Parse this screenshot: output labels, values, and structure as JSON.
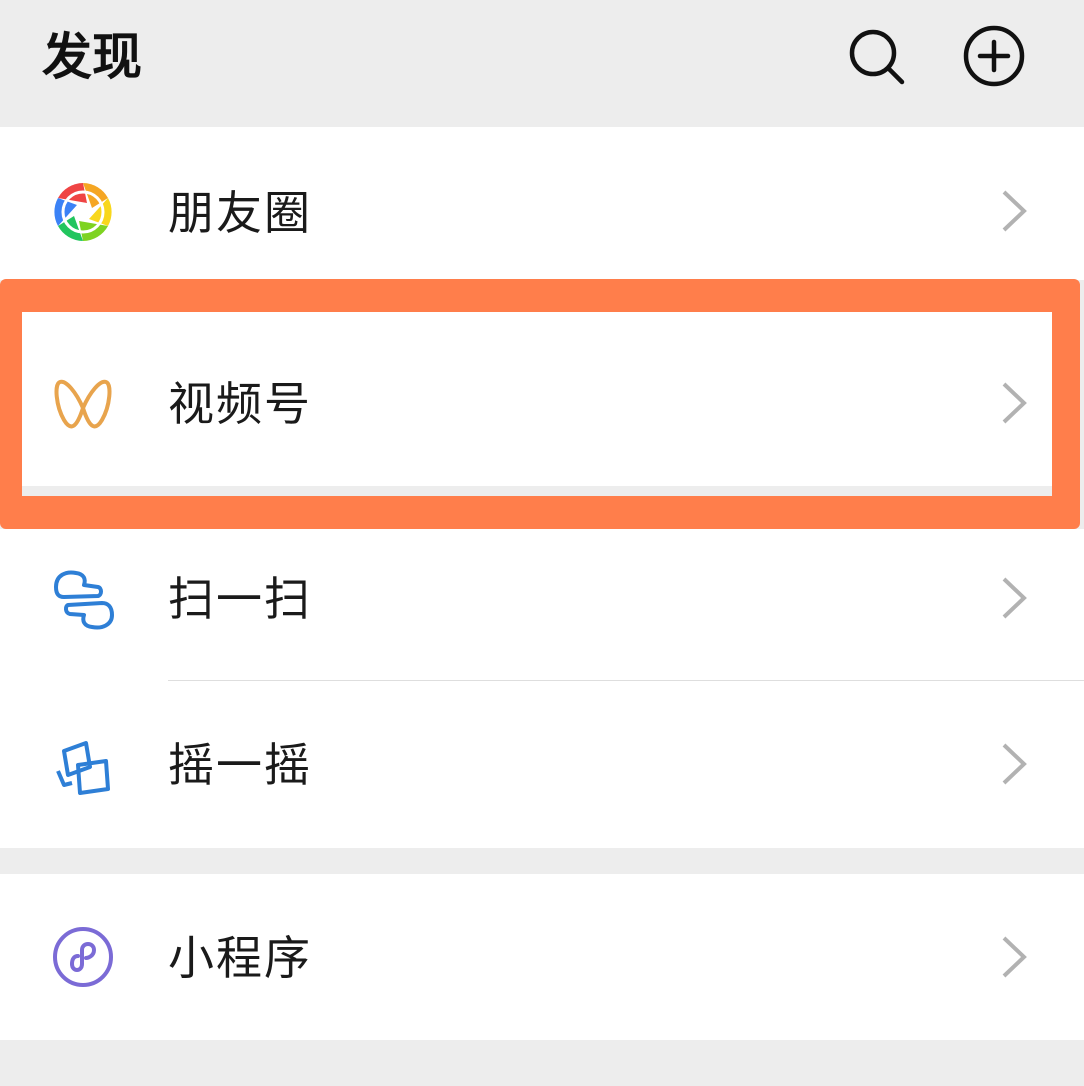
{
  "header": {
    "title": "发现",
    "search_icon": "search-icon",
    "add_icon": "plus-circle-icon"
  },
  "items": [
    {
      "label": "朋友圈",
      "icon": "moments-aperture-icon"
    },
    {
      "label": "视频号",
      "icon": "channels-icon",
      "highlighted": true
    },
    {
      "label": "扫一扫",
      "icon": "scan-icon"
    },
    {
      "label": "摇一摇",
      "icon": "shake-icon"
    },
    {
      "label": "小程序",
      "icon": "mini-program-icon"
    }
  ],
  "colors": {
    "background": "#ededed",
    "highlight": "#ff7e4b",
    "channels": "#e8a44d",
    "scan_shake": "#2e7fd6",
    "mini_program": "#7b6bd6"
  }
}
